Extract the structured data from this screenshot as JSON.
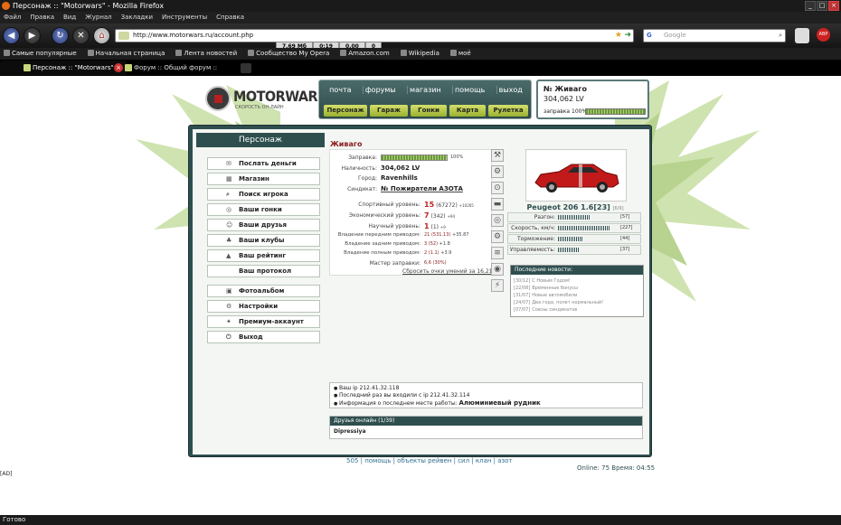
{
  "browser": {
    "title": "Персонаж :: \"Motorwars\" - Mozilla Firefox",
    "menu": [
      "Файл",
      "Правка",
      "Вид",
      "Журнал",
      "Закладки",
      "Инструменты",
      "Справка"
    ],
    "url": "http://www.motorwars.ru/account.php",
    "search_placeholder": "Google",
    "search_engine": "G",
    "stats": [
      "7.69 Мб",
      "0:19",
      "0.00",
      "0"
    ],
    "bookmarks": [
      "Самые популярные",
      "Начальная страница",
      "Лента новостей",
      "Сообщество My Opera",
      "Amazon.com",
      "Wikipedia",
      "моё"
    ],
    "tabs": [
      "Персонаж :: \"Motorwars\"",
      "Форум :: Общий форум :: \"Motorwars\""
    ],
    "status": "Готово"
  },
  "site": {
    "logo": "MOTORWARS.RU",
    "logo_sub": "СКОРОСТЬ ОН-ЛАЙН",
    "top_links": [
      "почта",
      "форумы",
      "магазин",
      "помощь",
      "выход"
    ],
    "top_buttons": [
      "Персонаж",
      "Гараж",
      "Гонки",
      "Карта",
      "Рулетка"
    ],
    "user": {
      "name": "№ Живаго",
      "balance": "304,062 LV",
      "fuel_label": "заправка 100%"
    }
  },
  "sidebar": {
    "title": "Персонаж",
    "items": [
      {
        "label": "Послать деньги",
        "icon": "money-icon"
      },
      {
        "label": "Магазин",
        "icon": "shop-icon"
      },
      {
        "label": "Поиск игрока",
        "icon": "search-icon"
      },
      {
        "label": "Ваши гонки",
        "icon": "race-icon"
      },
      {
        "label": "Ваши друзья",
        "icon": "friends-icon"
      },
      {
        "label": "Ваши клубы",
        "icon": "clubs-icon"
      },
      {
        "label": "Ваш рейтинг",
        "icon": "rating-icon"
      },
      {
        "label": "Ваш протокол",
        "icon": ""
      },
      {
        "label": "Фотоальбом",
        "icon": "photo-icon"
      },
      {
        "label": "Настройки",
        "icon": "settings-icon"
      },
      {
        "label": "Премиум-аккаунт",
        "icon": "premium-icon"
      },
      {
        "label": "Выход",
        "icon": "exit-icon"
      }
    ]
  },
  "character": {
    "name": "Живаго",
    "fuel_label": "Заправка:",
    "fuel_pct": "100%",
    "fuel_fraction": 1.0,
    "cash_label": "Наличность:",
    "cash": "304,062 LV",
    "city_label": "Город:",
    "city": "Ravenhills",
    "syndicate_label": "Синдикат:",
    "syndicate": "№ Пожиратели АЗОТА",
    "levels": [
      {
        "label": "Спортивный уровень:",
        "val": "15",
        "extra": "(67272)",
        "bonus": "+10265"
      },
      {
        "label": "Экономический уровень:",
        "val": "7",
        "extra": "(342)",
        "bonus": "+94"
      },
      {
        "label": "Научный уровень:",
        "val": "1",
        "extra": "(1)",
        "bonus": "+9"
      }
    ],
    "drive": [
      {
        "label": "Владение передним приводом:",
        "val": "21 (531.13)",
        "bonus": "+35.87"
      },
      {
        "label": "Владение задним приводом:",
        "val": "3 (52)",
        "bonus": "+1.8"
      },
      {
        "label": "Владение полным приводом:",
        "val": "2 (1.1)",
        "bonus": "+3.9"
      }
    ],
    "master_label": "Мастер заправки:",
    "master": "6,6 (30%)",
    "reset": "Сбросить очки умений за 16,217 LV"
  },
  "car": {
    "name": "Peugeot 206 1.6",
    "level": "[23]",
    "extra": "[6/9]",
    "stats": [
      {
        "label": "Разгон:",
        "val": "[57]",
        "level": 0.57
      },
      {
        "label": "Скорость, км/ч:",
        "val": "[227]",
        "level": 0.9
      },
      {
        "label": "Торможение:",
        "val": "[44]",
        "level": 0.44
      },
      {
        "label": "Управляемость:",
        "val": "[37]",
        "level": 0.37
      }
    ]
  },
  "news": {
    "title": "Последние новости:",
    "items": [
      {
        "date": "[30/12]",
        "text": "С Новым Годом!"
      },
      {
        "date": "[22/08]",
        "text": "Временные бонусы"
      },
      {
        "date": "[31/07]",
        "text": "Новые автомобили"
      },
      {
        "date": "[24/07]",
        "text": "Два года, полет нормальный!"
      },
      {
        "date": "[07/07]",
        "text": "Союзы синдикатов"
      }
    ]
  },
  "ip": {
    "lines": [
      "Ваш ip 212.41.32.118",
      "Последний раз вы входили с ip 212.41.32.114"
    ],
    "work_label": "Информация о последнем месте работы:",
    "work": "Алюминиевый рудник"
  },
  "friends": {
    "title": "Друзья онлайн (1/39)",
    "names": [
      "Dipressiya"
    ]
  },
  "footer": {
    "links": [
      "505",
      "помощь",
      "объекты рейвен",
      "сил",
      "клан",
      "азот"
    ],
    "online": "Online: 75  Время: 04:55",
    "ad": "[AD]"
  }
}
